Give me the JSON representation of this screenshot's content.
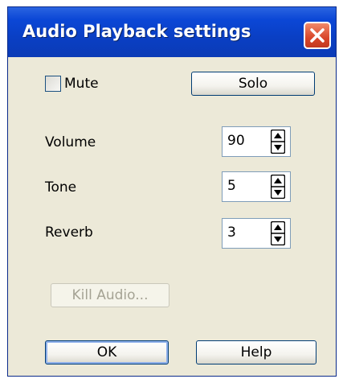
{
  "window": {
    "title": "Audio Playback settings"
  },
  "mute": {
    "label": "Mute",
    "checked": false
  },
  "buttons": {
    "solo": "Solo",
    "kill": "Kill Audio...",
    "ok": "OK",
    "help": "Help"
  },
  "settings": [
    {
      "label": "Volume",
      "value": "90"
    },
    {
      "label": "Tone",
      "value": "5"
    },
    {
      "label": "Reverb",
      "value": "3"
    }
  ],
  "icons": {
    "close": "close-icon",
    "spin_up": "spin-up-icon",
    "spin_down": "spin-down-icon"
  }
}
